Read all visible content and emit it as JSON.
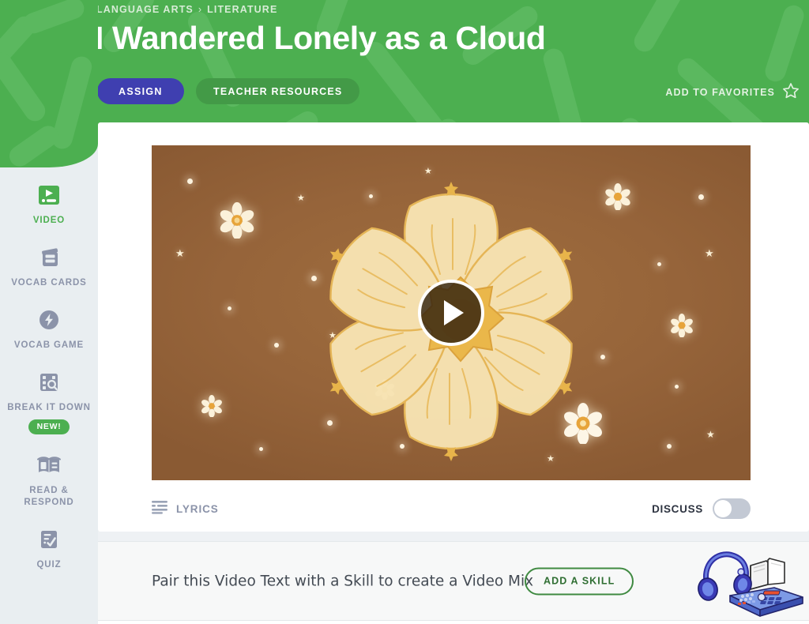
{
  "header": {
    "breadcrumb": {
      "items": [
        "LANGUAGE ARTS",
        "LITERATURE"
      ],
      "separator": "›"
    },
    "title": "I Wandered Lonely as a Cloud",
    "assign_label": "ASSIGN",
    "teacher_resources_label": "TEACHER RESOURCES",
    "favorites_label": "ADD TO FAVORITES",
    "favorites_icon": "star-outline-icon",
    "background_color": "#4caf50",
    "assign_color": "#3f3fb0",
    "teacher_resources_color": "#439a47"
  },
  "sidebar": {
    "background_color": "#e9eef1",
    "items": [
      {
        "label": "VIDEO",
        "icon": "video-icon",
        "active": true,
        "badge": null
      },
      {
        "label": "VOCAB CARDS",
        "icon": "vocab-cards-icon",
        "active": false,
        "badge": null
      },
      {
        "label": "VOCAB GAME",
        "icon": "vocab-game-icon",
        "active": false,
        "badge": null
      },
      {
        "label": "BREAK IT DOWN",
        "icon": "break-it-down-icon",
        "active": false,
        "badge": "NEW!"
      },
      {
        "label": "READ & RESPOND",
        "icon": "read-respond-icon",
        "active": false,
        "badge": null
      },
      {
        "label": "QUIZ",
        "icon": "quiz-icon",
        "active": false,
        "badge": null
      }
    ],
    "active_color": "#4caf50",
    "inactive_color": "#8b93a9"
  },
  "player": {
    "play_icon": "play-icon",
    "background_color": "#96643a",
    "flower_color": "#f5e0ad",
    "flower_center_color": "#e8a83a",
    "lyrics_label": "LYRICS",
    "lyrics_icon": "lyrics-lines-icon",
    "discuss_label": "DISCUSS",
    "discuss_toggle_state": "off"
  },
  "skill_strip": {
    "text": "Pair this Video Text with a Skill to create a Video Mix",
    "button_label": "ADD A SKILL",
    "button_color": "#3f8a41",
    "illustration": "headphones-book-drummachine-illustration"
  }
}
